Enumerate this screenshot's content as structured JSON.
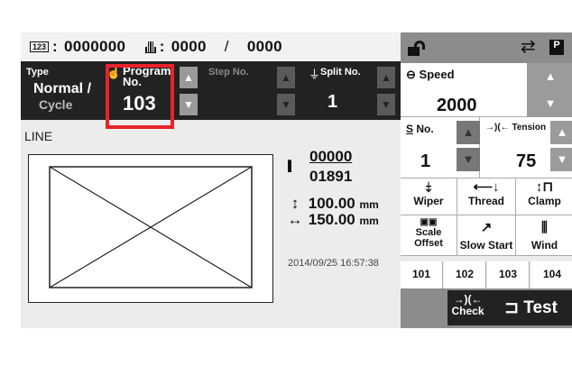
{
  "counter": {
    "icon_a_text": "123",
    "count": "0000000",
    "count2": "0000",
    "slash": "/",
    "count3": "0000"
  },
  "header_right": {
    "p_icon_text": "P"
  },
  "params": {
    "type_label": "Type",
    "type_value1": "Normal /",
    "type_value2": "Cycle",
    "program_label": "Program No.",
    "program_value": "103",
    "step_label": "Step No.",
    "split_label": "Split No.",
    "split_value": "1"
  },
  "pattern": {
    "label": "LINE",
    "stitch_current": "00000",
    "stitch_total": "01891",
    "dim_y": "100.00",
    "dim_x": "150.00",
    "unit": "mm",
    "datetime": "2014/09/25 16:57:38"
  },
  "speed": {
    "label": "Speed",
    "value": "2000"
  },
  "s_no": {
    "label": "No.",
    "value": "1"
  },
  "tension": {
    "label": "Tension",
    "value": "75"
  },
  "functions": {
    "wiper": "Wiper",
    "thread": "Thread",
    "clamp": "Clamp",
    "scale_offset_1": "Scale",
    "scale_offset_2": "Offset",
    "slow_start": "Slow Start",
    "wind": "Wind"
  },
  "programs": [
    "101",
    "102",
    "103",
    "104"
  ],
  "bottom": {
    "check": "Check",
    "test": "Test"
  },
  "colors": {
    "highlight": "#e8232a",
    "dark_bar": "#222222",
    "header_gray": "#8c8c8c"
  }
}
